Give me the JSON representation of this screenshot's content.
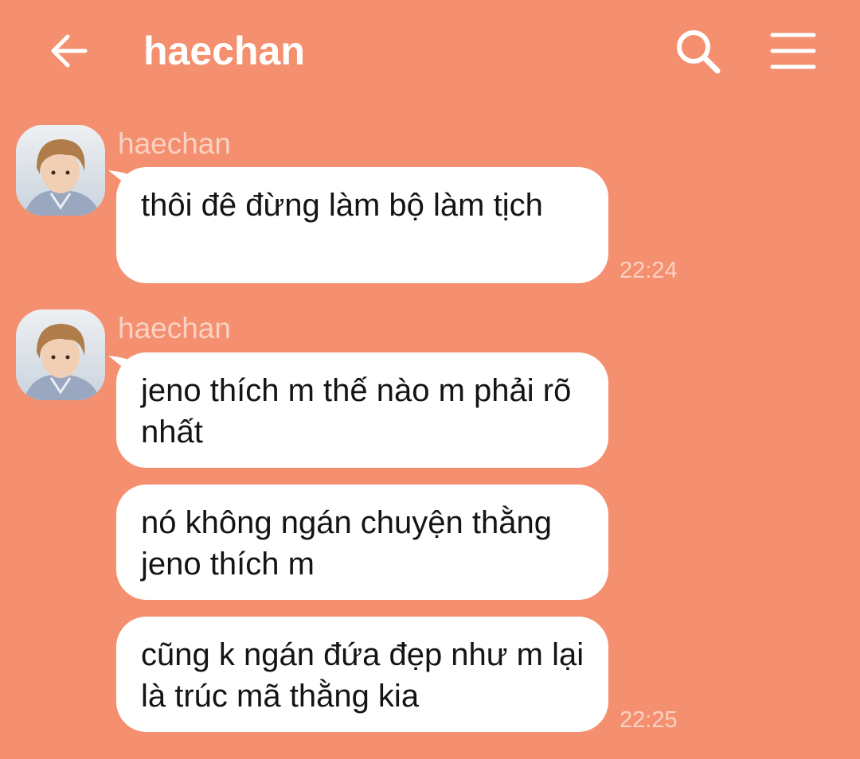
{
  "header": {
    "title": "haechan",
    "back_icon": "arrow-left-icon",
    "search_icon": "search-icon",
    "menu_icon": "hamburger-menu-icon"
  },
  "colors": {
    "background": "#F4906F",
    "bubble": "#FFFFFF",
    "muted_text": "#FAD1C2",
    "message_text": "#141414"
  },
  "messages": [
    {
      "sender": "haechan",
      "text": "thôi đê đừng làm bộ làm tịch",
      "time": "22:24"
    },
    {
      "sender": "haechan",
      "text": "jeno thích m thế nào m phải rõ nhất"
    },
    {
      "text": "nó không ngán chuyện thằng jeno thích m"
    },
    {
      "text": "cũng k ngán đứa đẹp như m lại là trúc mã thằng kia",
      "time": "22:25"
    }
  ]
}
